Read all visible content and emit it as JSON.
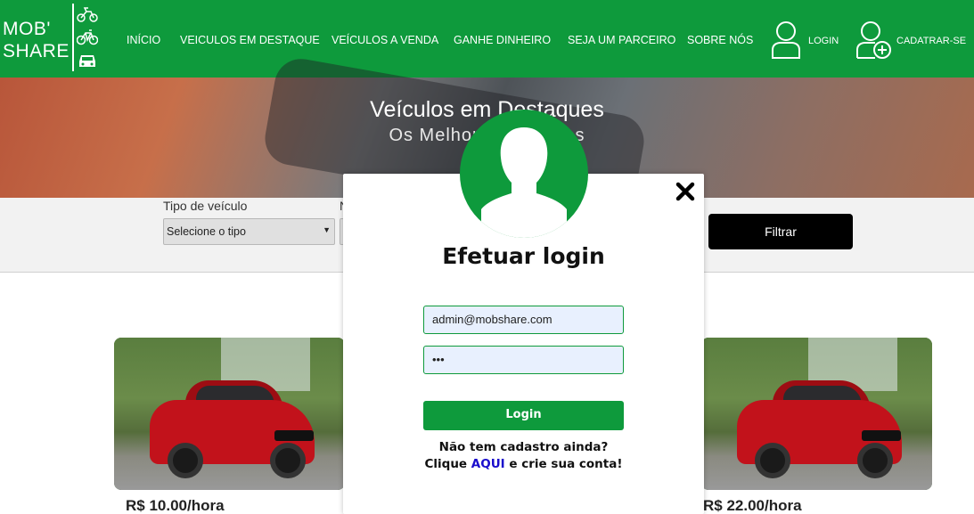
{
  "logo": {
    "line1": "MOB'",
    "line2": "SHARE"
  },
  "nav": {
    "items": [
      {
        "label": "INÍCIO"
      },
      {
        "label": "VEICULOS EM DESTAQUE"
      },
      {
        "label": "VEÍCULOS A VENDA"
      },
      {
        "label": "GANHE DINHEIRO"
      },
      {
        "label": "SEJA UM PARCEIRO"
      },
      {
        "label": "SOBRE NÓS"
      }
    ],
    "login_label": "LOGIN",
    "signup_label": "CADATRAR-SE"
  },
  "banner": {
    "title": "Veículos em Destaques",
    "subtitle": "Os Melhores Anúncios"
  },
  "filter": {
    "type_label": "Tipo de veículo",
    "type_value": "Selecione o tipo",
    "second_label": "N",
    "button_label": "Filtrar"
  },
  "cards": [
    {
      "price": "R$ 10.00/hora"
    },
    {
      "price": "R$ 22.00/hora"
    }
  ],
  "modal": {
    "title": "Efetuar login",
    "email_value": "admin@mobshare.com",
    "password_value": "•••",
    "login_button": "Login",
    "signup_line1": "Não tem cadastro ainda?",
    "signup_prefix": "Clique ",
    "signup_link": "AQUI",
    "signup_suffix": " e crie sua conta!"
  },
  "colors": {
    "brand": "#0e9a3c",
    "link": "#1a0dcc"
  }
}
